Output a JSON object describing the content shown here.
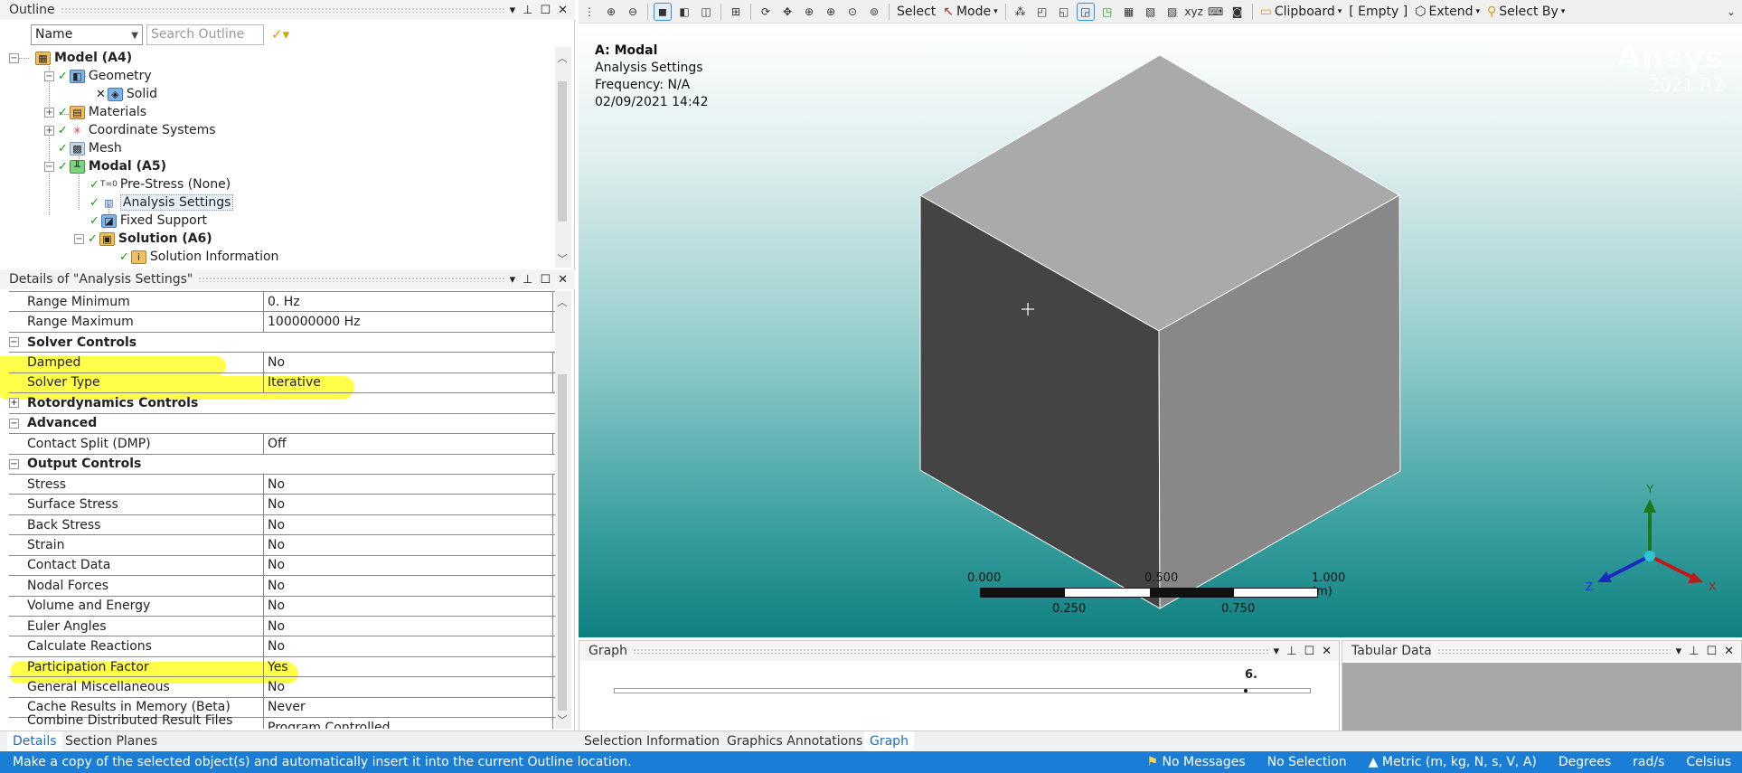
{
  "outline": {
    "title": "Outline",
    "name_combo": "Name",
    "search_placeholder": "Search Outline",
    "tree": [
      {
        "label": "Model (A4)",
        "bold": true
      },
      {
        "label": "Geometry"
      },
      {
        "label": "Solid"
      },
      {
        "label": "Materials"
      },
      {
        "label": "Coordinate Systems"
      },
      {
        "label": "Mesh"
      },
      {
        "label": "Modal (A5)",
        "bold": true
      },
      {
        "label": "Pre-Stress (None)"
      },
      {
        "label": "Analysis Settings",
        "selected": true
      },
      {
        "label": "Fixed Support"
      },
      {
        "label": "Solution (A6)",
        "bold": true
      },
      {
        "label": "Solution Information"
      }
    ]
  },
  "details": {
    "title": "Details of \"Analysis Settings\"",
    "rows": [
      {
        "k": "Range Minimum",
        "v": "0. Hz"
      },
      {
        "k": "Range Maximum",
        "v": "100000000 Hz"
      },
      {
        "k": "Solver Controls",
        "section": true,
        "exp": "−"
      },
      {
        "k": "Damped",
        "v": "No"
      },
      {
        "k": "Solver Type",
        "v": "Iterative"
      },
      {
        "k": "Rotordynamics Controls",
        "section": true,
        "exp": "+"
      },
      {
        "k": "Advanced",
        "section": true,
        "exp": "−"
      },
      {
        "k": "Contact Split (DMP)",
        "v": "Off"
      },
      {
        "k": "Output Controls",
        "section": true,
        "exp": "−"
      },
      {
        "k": "Stress",
        "v": "No"
      },
      {
        "k": "Surface Stress",
        "v": "No"
      },
      {
        "k": "Back Stress",
        "v": "No"
      },
      {
        "k": "Strain",
        "v": "No"
      },
      {
        "k": "Contact Data",
        "v": "No"
      },
      {
        "k": "Nodal Forces",
        "v": "No"
      },
      {
        "k": "Volume and Energy",
        "v": "No"
      },
      {
        "k": "Euler Angles",
        "v": "No"
      },
      {
        "k": "Calculate Reactions",
        "v": "No"
      },
      {
        "k": "Participation Factor",
        "v": "Yes"
      },
      {
        "k": "General Miscellaneous",
        "v": "No"
      },
      {
        "k": "Cache Results in Memory (Beta)",
        "v": "Never"
      },
      {
        "k": "Combine Distributed Result Files (Beta)",
        "v": "Program Controlled"
      }
    ]
  },
  "left_tabs": [
    "Details",
    "Section Planes"
  ],
  "toolbar": {
    "select": "Select",
    "mode": "Mode",
    "clipboard": "Clipboard",
    "empty": "[ Empty ]",
    "extend": "Extend",
    "select_by": "Select By"
  },
  "viewport": {
    "title": "A: Modal",
    "line2": "Analysis Settings",
    "line3": "Frequency: N/A",
    "line4": "02/09/2021 14:42",
    "brand": "Ansys",
    "release": "2021 R2",
    "scale_top": [
      "0.000",
      "0.500",
      "1.000 (m)"
    ],
    "scale_bottom": [
      "0.250",
      "0.750"
    ],
    "triad": {
      "x": "X",
      "y": "Y",
      "z": "Z"
    }
  },
  "graph": {
    "title": "Graph",
    "value": "6."
  },
  "tabular": {
    "title": "Tabular Data"
  },
  "viewport_tabs": [
    "Selection Information",
    "Graphics Annotations",
    "Graph"
  ],
  "status": {
    "message": "Make a copy of the selected object(s) and automatically insert it into the current Outline location.",
    "messages": "No Messages",
    "selection": "No Selection",
    "units": "Metric (m, kg, N, s, V, A)",
    "angle": "Degrees",
    "rate": "rad/s",
    "temp": "Celsius"
  },
  "colors": {
    "highlight": "#ffff35",
    "status": "#1a7dd6",
    "accent": "#1a6fc0"
  }
}
